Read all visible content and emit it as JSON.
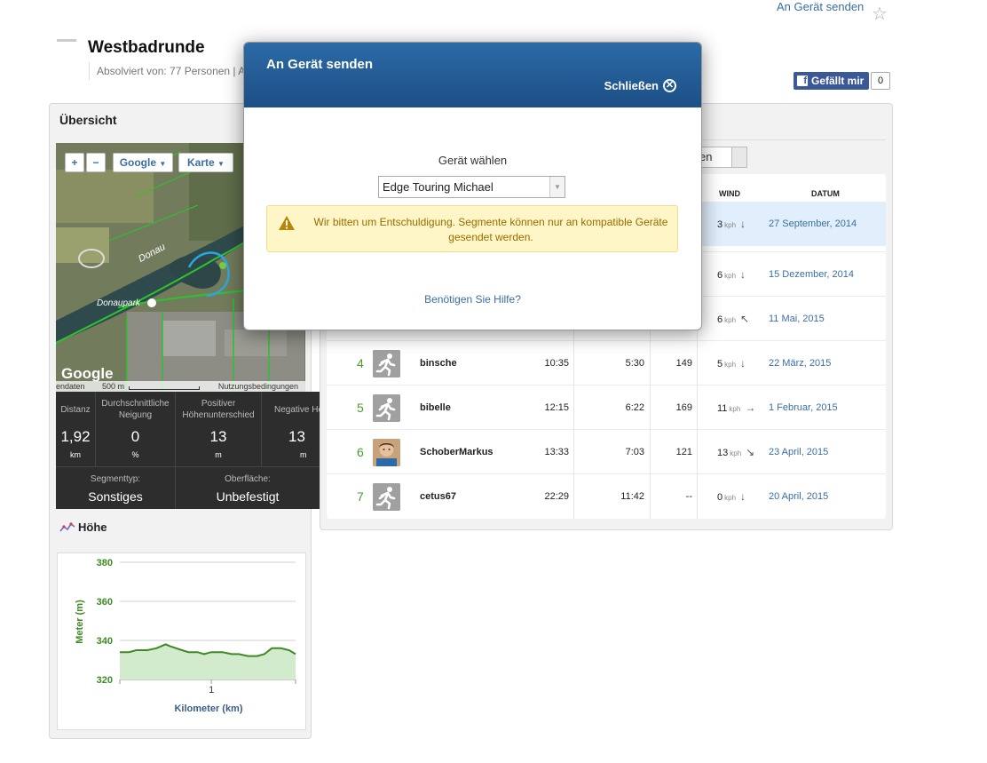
{
  "header": {
    "send_link": "An Gerät senden",
    "title": "Westbadrunde",
    "subline": "Absolviert von: 77 Personen | A",
    "fb_like": "Gefällt mir",
    "fb_count": "0"
  },
  "overview": {
    "title": "Übersicht",
    "map": {
      "zoom_in": "+",
      "zoom_out": "−",
      "provider": "Google",
      "type": "Karte",
      "label_river": "Donau",
      "label_park": "Donaupark",
      "google_logo": "Google",
      "footer_left": "endaten",
      "scale": "500 m",
      "footer_right": "Nutzungsbedingungen"
    },
    "stats": [
      {
        "label": "Distanz",
        "value": "1,92",
        "unit": "km"
      },
      {
        "label": "Durchschnittliche Neigung",
        "value": "0",
        "unit": "%"
      },
      {
        "label": "Positiver Höhenunterschied",
        "value": "13",
        "unit": "m"
      },
      {
        "label": "Negative Höhenunters",
        "value": "13",
        "unit": "m"
      }
    ],
    "segment_type": {
      "label": "Segmenttyp:",
      "value": "Sonstiges"
    },
    "surface": {
      "label": "Oberfläche:",
      "value": "Unbefestigt"
    }
  },
  "hoehe": {
    "title": "Höhe"
  },
  "chart_data": {
    "type": "area",
    "xlabel": "Kilometer (km)",
    "ylabel": "Meter (m)",
    "ylim": [
      320,
      380
    ],
    "yticks": [
      320,
      340,
      360,
      380
    ],
    "xticks": [
      1
    ],
    "xlim": [
      0,
      1.92
    ],
    "grid": true,
    "x": [
      0,
      0.1,
      0.18,
      0.3,
      0.4,
      0.5,
      0.55,
      0.68,
      0.75,
      0.85,
      0.92,
      1.0,
      1.12,
      1.22,
      1.3,
      1.4,
      1.5,
      1.58,
      1.66,
      1.76,
      1.85,
      1.92
    ],
    "values": [
      334,
      334,
      335,
      335,
      336,
      338,
      337,
      335,
      334,
      334,
      333,
      334,
      334,
      333,
      333,
      332,
      332,
      333,
      336,
      336,
      335,
      333
    ]
  },
  "table": {
    "dropdown_fragment": "en",
    "headers": {
      "wind": "WIND",
      "date": "DATUM"
    },
    "wind_unit": "kph",
    "rows": [
      {
        "rank": "",
        "name": "",
        "time": "",
        "pace": "",
        "hr": "",
        "wind": "3",
        "wind_dir": "↓",
        "date": "27 September, 2014",
        "avatar": "none",
        "highlight": true
      },
      {
        "rank": "",
        "name": "",
        "time": "",
        "pace": "",
        "hr": "",
        "wind": "6",
        "wind_dir": "↓",
        "date": "15 Dezember, 2014",
        "avatar": "none",
        "highlight": false
      },
      {
        "rank": "",
        "name": "",
        "time": "",
        "pace": "",
        "hr": "",
        "wind": "6",
        "wind_dir": "↖",
        "date": "11 Mai, 2015",
        "avatar": "none",
        "highlight": false
      },
      {
        "rank": "4",
        "name": "binsche",
        "time": "10:35",
        "pace": "5:30",
        "hr": "149",
        "wind": "5",
        "wind_dir": "↓",
        "date": "22 März, 2015",
        "avatar": "runner",
        "highlight": false
      },
      {
        "rank": "5",
        "name": "bibelle",
        "time": "12:15",
        "pace": "6:22",
        "hr": "169",
        "wind": "11",
        "wind_dir": "→",
        "date": "1 Februar, 2015",
        "avatar": "runner",
        "highlight": false
      },
      {
        "rank": "6",
        "name": "SchoberMarkus",
        "time": "13:33",
        "pace": "7:03",
        "hr": "121",
        "wind": "13",
        "wind_dir": "↘",
        "date": "23 April, 2015",
        "avatar": "photo",
        "highlight": false
      },
      {
        "rank": "7",
        "name": "cetus67",
        "time": "22:29",
        "pace": "11:42",
        "hr": "--",
        "wind": "0",
        "wind_dir": "↓",
        "date": "20 April, 2015",
        "avatar": "runner",
        "highlight": false
      }
    ]
  },
  "modal": {
    "title": "An Gerät senden",
    "close": "Schließen",
    "device_label": "Gerät wählen",
    "device_selected": "Edge Touring Michael",
    "warning": "Wir bitten um Entschuldigung. Segmente können nur an kompatible Geräte gesendet werden.",
    "help": "Benötigen Sie Hilfe?"
  },
  "colors": {
    "accent": "#3a6ea5",
    "rank_green": "#4a9b2e",
    "modal_header": "#1c4f86",
    "warning_bg": "#fef6c7"
  }
}
